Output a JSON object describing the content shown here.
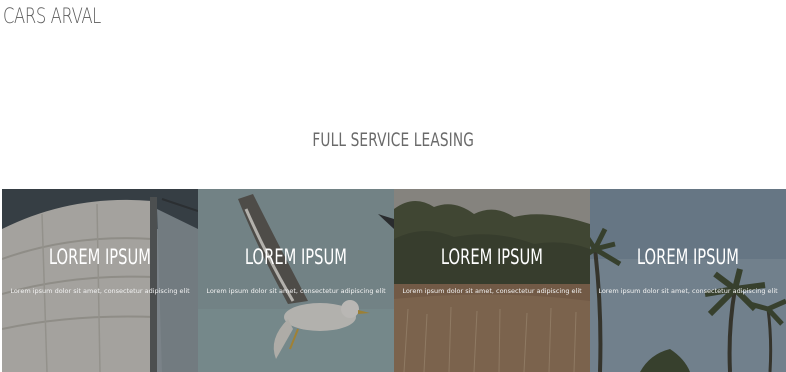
{
  "header": {
    "brand": "CARS ARVAL"
  },
  "section": {
    "title": "FULL SERVICE LEASING"
  },
  "tiles": [
    {
      "heading": "LOREM IPSUM",
      "text": "Lorem ipsum dolor sit amet, consectetur adipiscing elit",
      "image_icon": "sailboat-image"
    },
    {
      "heading": "LOREM IPSUM",
      "text": "Lorem ipsum dolor sit amet, consectetur adipiscing elit",
      "image_icon": "seagull-image"
    },
    {
      "heading": "LOREM IPSUM",
      "text": "Lorem ipsum dolor sit amet, consectetur adipiscing elit",
      "image_icon": "field-trees-image"
    },
    {
      "heading": "LOREM IPSUM",
      "text": "Lorem ipsum dolor sit amet, consectetur adipiscing elit",
      "image_icon": "palm-trees-image"
    }
  ],
  "colors": {
    "brand_text": "#5a5a5a",
    "title_text": "#6a6a6a",
    "overlay_text": "#ffffff"
  }
}
